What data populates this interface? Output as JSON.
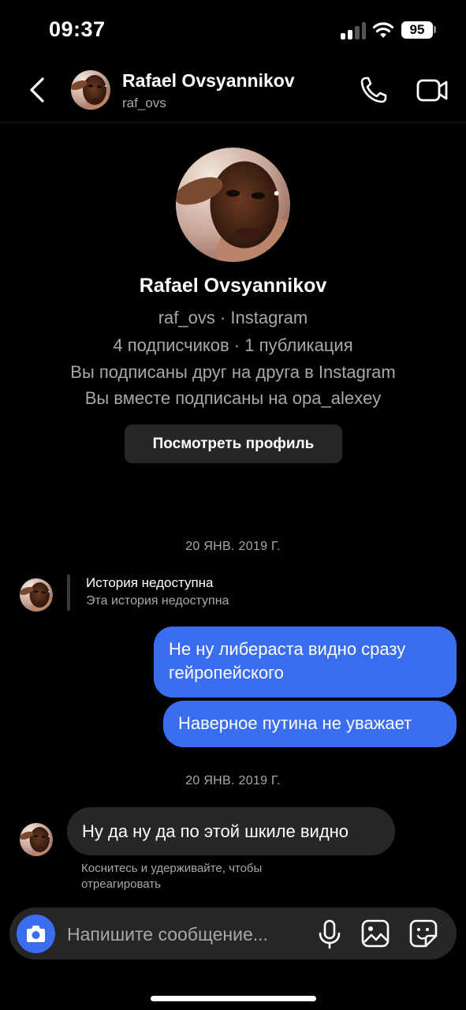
{
  "status_bar": {
    "time": "09:37",
    "battery": "95"
  },
  "header": {
    "name": "Rafael Ovsyannikov",
    "username": "raf_ovs",
    "icons": [
      "chevron-left-icon",
      "phone-icon",
      "video-camera-icon"
    ]
  },
  "profile": {
    "name": "Rafael Ovsyannikov",
    "line1": "raf_ovs · Instagram",
    "line2": "4 подписчиков · 1 публикация",
    "line3": "Вы подписаны друг на друга в Instagram",
    "line4": "Вы вместе подписаны на opa_alexey",
    "view_profile_label": "Посмотреть профиль"
  },
  "thread": {
    "date1": "20 ЯНВ. 2019 Г.",
    "story": {
      "title": "История недоступна",
      "subtitle": "Эта история недоступна"
    },
    "outgoing": [
      {
        "line1": "Не ну либераста видно сразу",
        "line2": "гейропейского"
      },
      {
        "line1": "Наверное путина не уважает"
      }
    ],
    "date2": "20 ЯНВ. 2019 Г.",
    "incoming": {
      "text": "Ну да ну да по этой шкиле видно"
    },
    "react_hint": "Коснитесь и удерживайте, чтобы отреагировать"
  },
  "composer": {
    "placeholder": "Напишите сообщение...",
    "icons": [
      "camera-icon",
      "microphone-icon",
      "gallery-icon",
      "sticker-icon"
    ]
  },
  "colors": {
    "accent": "#3a6df0",
    "background": "#000000",
    "bubble_incoming": "#262626",
    "secondary_text": "#a8a8a8"
  }
}
